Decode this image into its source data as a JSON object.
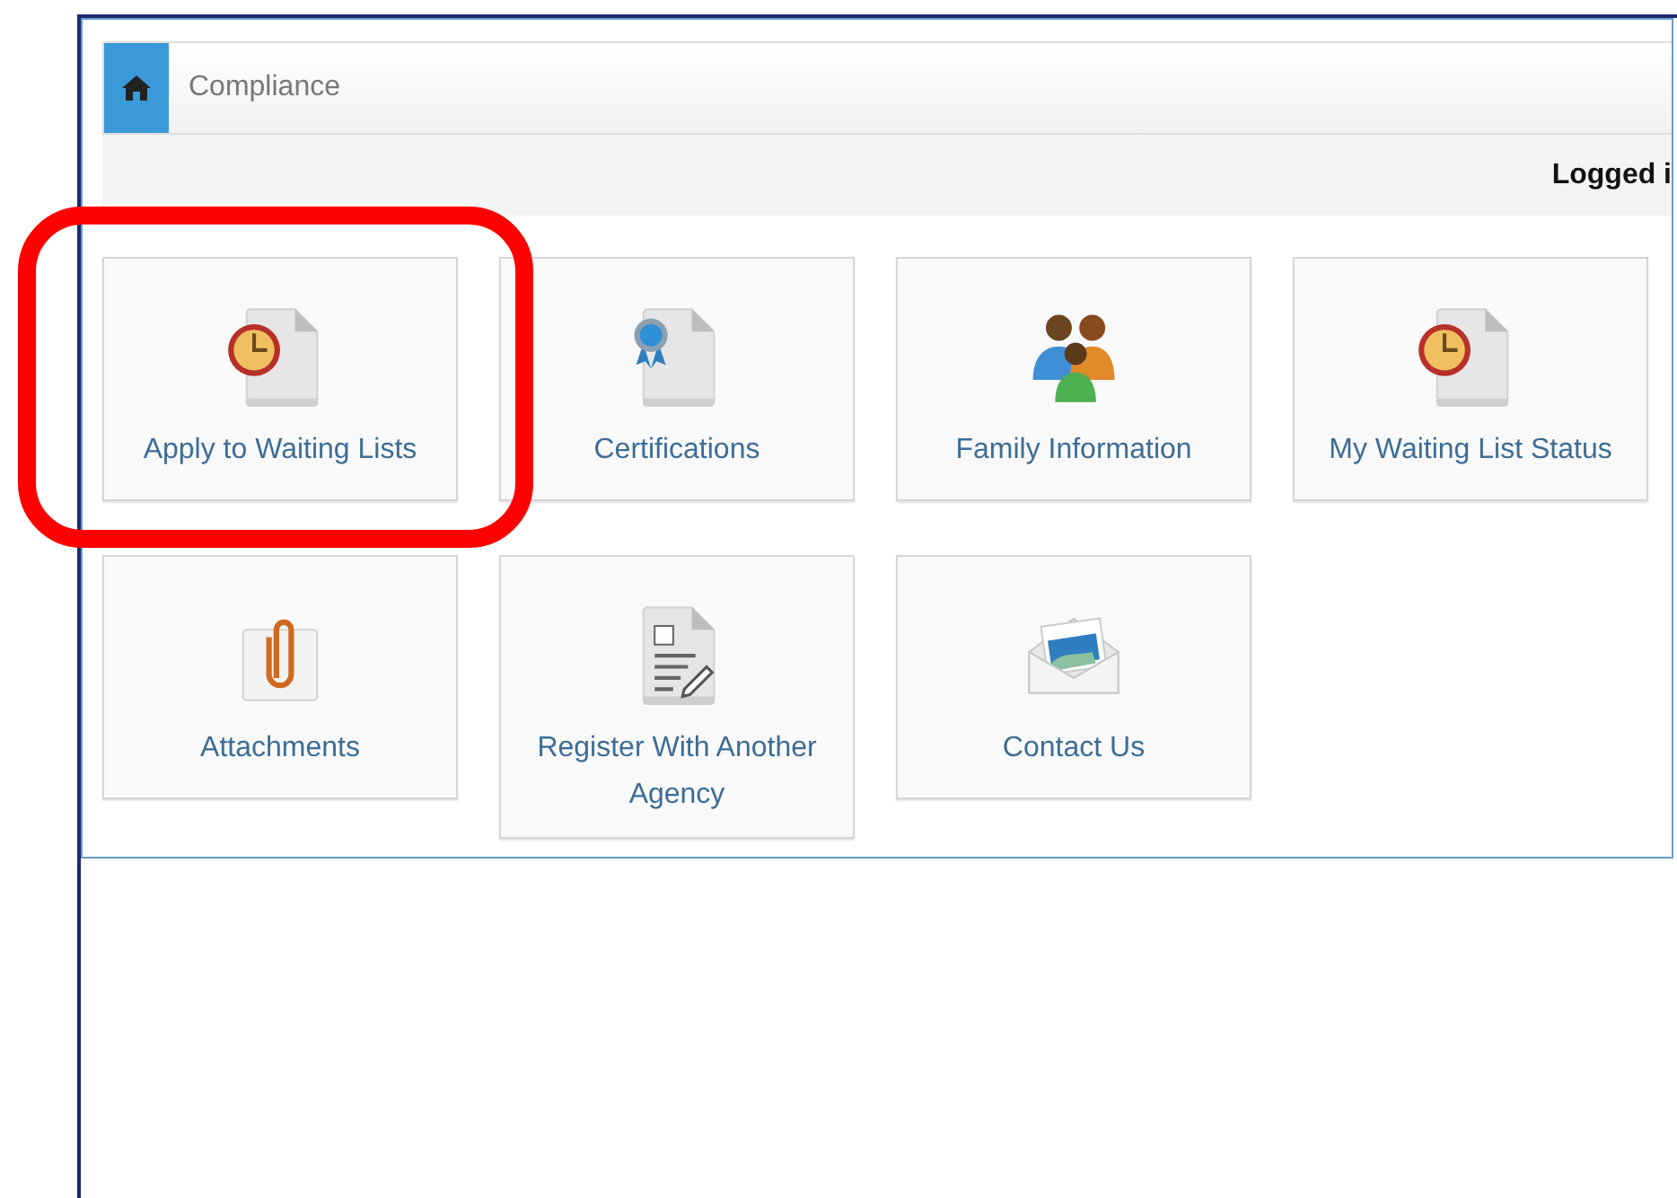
{
  "breadcrumb": {
    "title": "Compliance"
  },
  "user_bar": {
    "text": "Logged i"
  },
  "tiles": [
    {
      "label": "Apply to Waiting Lists",
      "highlighted": true
    },
    {
      "label": "Certifications",
      "highlighted": false
    },
    {
      "label": "Family Information",
      "highlighted": false
    },
    {
      "label": "My Waiting List Status",
      "highlighted": false
    },
    {
      "label": "Attachments",
      "highlighted": false
    },
    {
      "label": "Register With Another Agency",
      "highlighted": false
    },
    {
      "label": "Contact Us",
      "highlighted": false
    }
  ]
}
